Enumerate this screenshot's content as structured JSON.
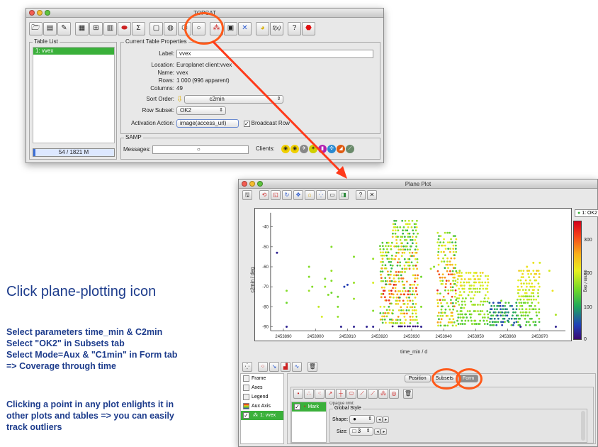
{
  "topcat": {
    "title": "TOPCAT",
    "toolbar_icons": [
      "load-table-icon",
      "save-icon",
      "edit-icon",
      "columns-icon",
      "hierarchy-icon",
      "stats-table-icon",
      "subsets-icon",
      "sigma-icon",
      "plane-plot-icon",
      "sky-plot-icon",
      "cube-plot-icon",
      "sphere-plot-icon",
      "match-icon",
      "multicone-icon",
      "cross-match-icon",
      "pacman-icon",
      "function-icon",
      "help-icon",
      "stop-icon"
    ],
    "function_label": "f(x)",
    "sigma_label": "Σ",
    "help_label": "?",
    "table_list": {
      "title": "Table List",
      "items": [
        "1: vvex"
      ]
    },
    "memory": {
      "text": "54 / 1821 M",
      "fraction": 0.03
    },
    "props": {
      "title": "Current Table Properties",
      "label_label": "Label:",
      "label_value": "vvex",
      "location_label": "Location:",
      "location_value": "Europlanet client:vvex",
      "name_label": "Name:",
      "name_value": "vvex",
      "rows_label": "Rows:",
      "rows_value": "1 000 (996 apparent)",
      "columns_label": "Columns:",
      "columns_value": "49",
      "sort_label": "Sort Order:",
      "sort_value": "c2min",
      "subset_label": "Row Subset:",
      "subset_value": "OK2",
      "activation_label": "Activation Action:",
      "activation_value": "image(access_url)",
      "broadcast_label": "Broadcast Row"
    },
    "samp": {
      "title": "SAMP",
      "messages_label": "Messages:",
      "clients_label": "Clients:"
    }
  },
  "plot": {
    "title": "Plane Plot",
    "legend_label": "1: OK2",
    "colorbar_ticks": [
      "300",
      "200",
      "100",
      "0"
    ],
    "colorbar_label": "c1min / deg",
    "layers": [
      "Frame",
      "Axes",
      "Legend",
      "Aux Axis",
      "1: vvex"
    ],
    "tabs": [
      "Position",
      "Subsets",
      "Form"
    ],
    "form": {
      "mark_label": "Mark",
      "opaque_label": "Opaque limit:",
      "global_style_label": "Global Style",
      "shape_label": "Shape:",
      "size_label": "Size:",
      "size_value": "3"
    }
  },
  "chart_data": {
    "type": "scatter",
    "xlabel": "time_min / d",
    "ylabel": "c2min / deg",
    "xlim": [
      2453886,
      2453978
    ],
    "ylim": [
      -92,
      -33
    ],
    "x_ticks": [
      2453890,
      2453900,
      2453910,
      2453920,
      2453930,
      2453940,
      2453950,
      2453960,
      2453970
    ],
    "y_ticks": [
      -40,
      -50,
      -60,
      -70,
      -80,
      -90
    ],
    "grid": false,
    "color_axis": {
      "label": "c1min / deg",
      "range": [
        0,
        360
      ]
    },
    "series": [
      {
        "points": [
          [
            2453888,
            -53,
            20
          ],
          [
            2453891,
            -72,
            160
          ],
          [
            2453891,
            -78,
            150
          ],
          [
            2453891,
            -90,
            20
          ],
          [
            2453898,
            -60,
            160
          ],
          [
            2453898,
            -65,
            160
          ],
          [
            2453898,
            -72,
            170
          ],
          [
            2453899,
            -70,
            160
          ],
          [
            2453901,
            -80,
            190
          ],
          [
            2453902,
            -85,
            200
          ],
          [
            2453903,
            -66,
            160
          ],
          [
            2453903,
            -70,
            170
          ],
          [
            2453904,
            -74,
            160
          ],
          [
            2453905,
            -50,
            160
          ],
          [
            2453905,
            -62,
            170
          ],
          [
            2453905,
            -67,
            160
          ],
          [
            2453905,
            -73,
            150
          ],
          [
            2453907,
            -75,
            150
          ],
          [
            2453907,
            -80,
            160
          ],
          [
            2453907,
            -85,
            170
          ],
          [
            2453908,
            -90,
            20
          ],
          [
            2453909,
            -70,
            40
          ],
          [
            2453910,
            -69,
            40
          ],
          [
            2453912,
            -55,
            160
          ],
          [
            2453912,
            -68,
            170
          ],
          [
            2453912,
            -76,
            170
          ],
          [
            2453912,
            -90,
            20
          ],
          [
            2453916,
            -90,
            20
          ],
          [
            2453918,
            -56,
            170
          ],
          [
            2453918,
            -68,
            200
          ],
          [
            2453918,
            -82,
            160
          ],
          [
            2453918,
            -90,
            20
          ],
          [
            2453933,
            -65,
            150
          ],
          [
            2453933,
            -80,
            160
          ],
          [
            2453933,
            -90,
            20
          ],
          [
            2453936,
            -61,
            180
          ],
          [
            2453937,
            -60,
            160
          ],
          [
            2453945,
            -62,
            180
          ],
          [
            2453950,
            -63,
            200
          ],
          [
            2453958,
            -77,
            160
          ],
          [
            2453959,
            -83,
            120
          ],
          [
            2453960,
            -87,
            80
          ],
          [
            2453962,
            -88,
            60
          ],
          [
            2453964,
            -90,
            20
          ],
          [
            2453966,
            -60,
            220
          ],
          [
            2453968,
            -58,
            220
          ],
          [
            2453970,
            -58,
            200
          ],
          [
            2453973,
            -62,
            200
          ],
          [
            2453974,
            -72,
            220
          ],
          [
            2453975,
            -84,
            180
          ],
          [
            2453975,
            -90,
            20
          ]
        ]
      }
    ],
    "clusters": [
      {
        "x": [
          2453920,
          2453924
        ],
        "y_top": -48,
        "y_bottom": -88,
        "color_profile": "mixed"
      },
      {
        "x": [
          2453924,
          2453932
        ],
        "y_top": -37,
        "y_bottom": -90,
        "color_profile": "mixed"
      },
      {
        "x": [
          2453938,
          2453944
        ],
        "y_top": -43,
        "y_bottom": -90,
        "color_profile": "mixed"
      },
      {
        "x": [
          2453944,
          2453954
        ],
        "y_top": -63,
        "y_bottom": -90,
        "color_profile": "yellow"
      },
      {
        "x": [
          2453954,
          2453963
        ],
        "y_top": -78,
        "y_bottom": -90,
        "color_profile": "dark"
      },
      {
        "x": [
          2453963,
          2453970
        ],
        "y_top": -62,
        "y_bottom": -90,
        "color_profile": "yellow"
      }
    ]
  },
  "text": {
    "heading": "Click plane-plotting icon",
    "para1": [
      "Select parameters time_min & C2min",
      "Select \"OK2\" in Subsets tab",
      "Select Mode=Aux & \"C1min\" in Form tab",
      "=> Coverage through time"
    ],
    "para2": [
      "Clicking a point in any plot enlights it in",
      "other plots and tables => you can easily",
      "track outliers"
    ]
  },
  "annotation_color": "#ff3a1a"
}
